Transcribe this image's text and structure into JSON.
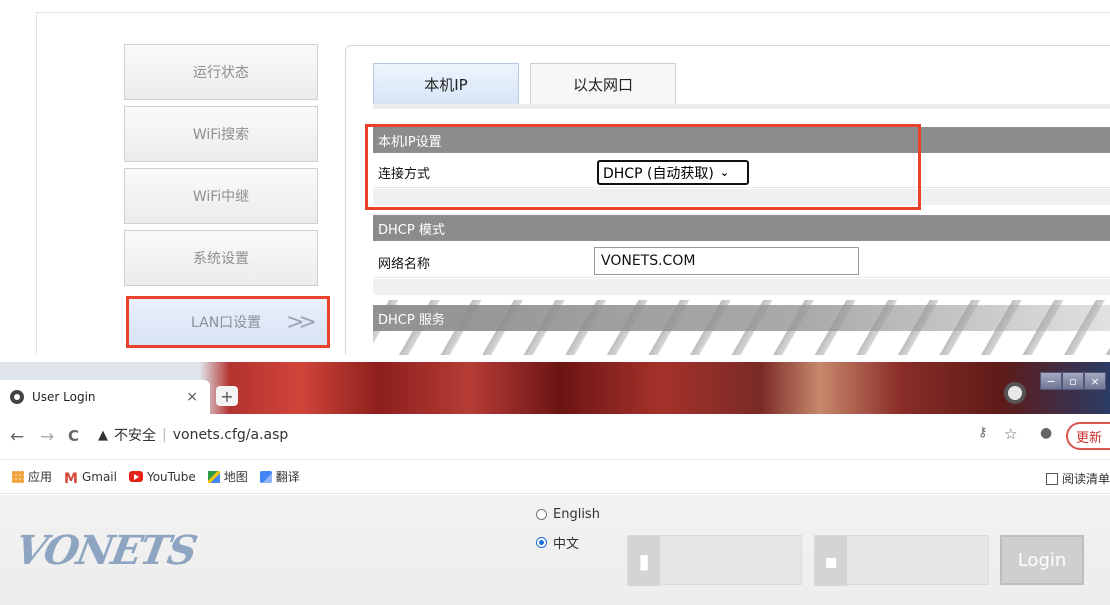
{
  "router": {
    "sidebar": [
      {
        "label": "运行状态"
      },
      {
        "label": "WiFi搜索"
      },
      {
        "label": "WiFi中继"
      },
      {
        "label": "系统设置"
      },
      {
        "label": "LAN口设置",
        "arrow": ">>"
      }
    ],
    "tabs": [
      {
        "label": "本机IP"
      },
      {
        "label": "以太网口"
      }
    ],
    "ip_section": {
      "title": "本机IP设置",
      "connection_label": "连接方式",
      "connection_value": "DHCP (自动获取)"
    },
    "dhcp_mode": {
      "title": "DHCP 模式",
      "network_name_label": "网络名称",
      "network_name_value": "VONETS.COM"
    },
    "dhcp_service": {
      "title": "DHCP 服务"
    },
    "highlight_color": "#e8412c"
  },
  "browser": {
    "tab": {
      "title": "User Login",
      "close": "×"
    },
    "new_tab": "+",
    "window_controls": [
      "−",
      "▫",
      "×"
    ],
    "nav": {
      "back": "←",
      "forward": "→",
      "reload": "C"
    },
    "address": {
      "insecure_label": "不安全",
      "url": "vonets.cfg/a.asp"
    },
    "toolbar_right": {
      "key_icon": "o-key",
      "star": "☆",
      "update_label": "更新"
    },
    "bookmarks": [
      {
        "label": "应用",
        "icon": "apps-icon"
      },
      {
        "label": "Gmail",
        "icon": "gmail-icon"
      },
      {
        "label": "YouTube",
        "icon": "youtube-icon"
      },
      {
        "label": "地图",
        "icon": "maps-icon"
      },
      {
        "label": "翻译",
        "icon": "translate-icon"
      }
    ],
    "reading_list": "阅读清单"
  },
  "login_page": {
    "logo": "VONETS",
    "languages": [
      {
        "label": "English",
        "selected": false
      },
      {
        "label": "中文",
        "selected": true
      }
    ],
    "username_placeholder": "",
    "password_placeholder": "",
    "login_button": "Login"
  }
}
